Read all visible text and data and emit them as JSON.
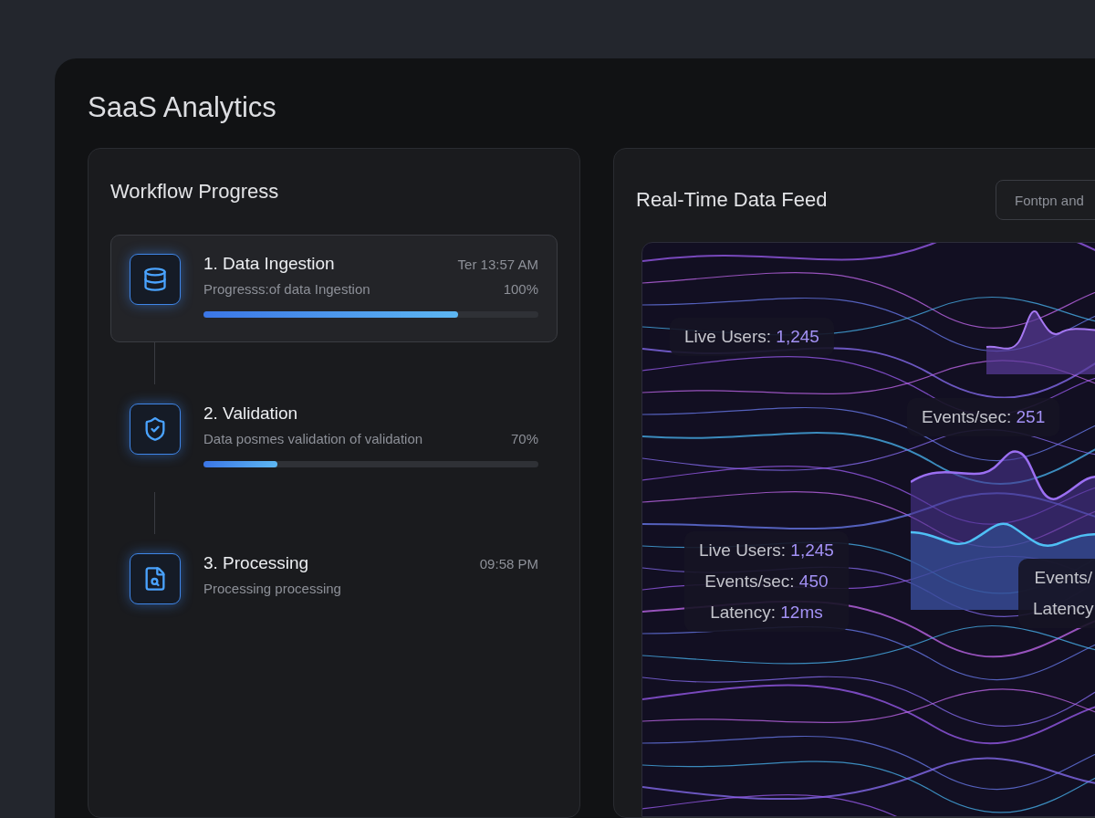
{
  "app": {
    "title": "SaaS Analytics"
  },
  "workflow": {
    "title": "Workflow Progress",
    "steps": [
      {
        "kind": "database",
        "title": "1. Data Ingestion",
        "time": "Ter 13:57 AM",
        "description": "Progresss:of data Ingestion",
        "percent": "100%",
        "level": 0.76,
        "selected": true
      },
      {
        "kind": "shield",
        "title": "2. Validation",
        "description": "Data posmes validation of validation",
        "percent": "70%",
        "level": 0.22,
        "selected": false
      },
      {
        "kind": "clipboard",
        "title": "3. Processing",
        "time": "09:58 PM",
        "description": "Processing processing",
        "selected": false
      }
    ]
  },
  "feed": {
    "title": "Real-Time Data Feed",
    "filter_button": "Fontpn and",
    "stat_cards": [
      {
        "stats": [
          {
            "label": "Live Users:",
            "value": "1,245"
          }
        ]
      },
      {
        "stats": [
          {
            "label": "Events/sec:",
            "value": "251"
          }
        ]
      },
      {
        "stats": [
          {
            "label": "Live Users:",
            "value": "1,245"
          },
          {
            "label": "Events/sec:",
            "value": "450"
          },
          {
            "label": "Latency:",
            "value": "12ms"
          }
        ]
      },
      {
        "stats": [
          {
            "label": "Events/"
          },
          {
            "label": "Latency"
          }
        ]
      }
    ]
  }
}
